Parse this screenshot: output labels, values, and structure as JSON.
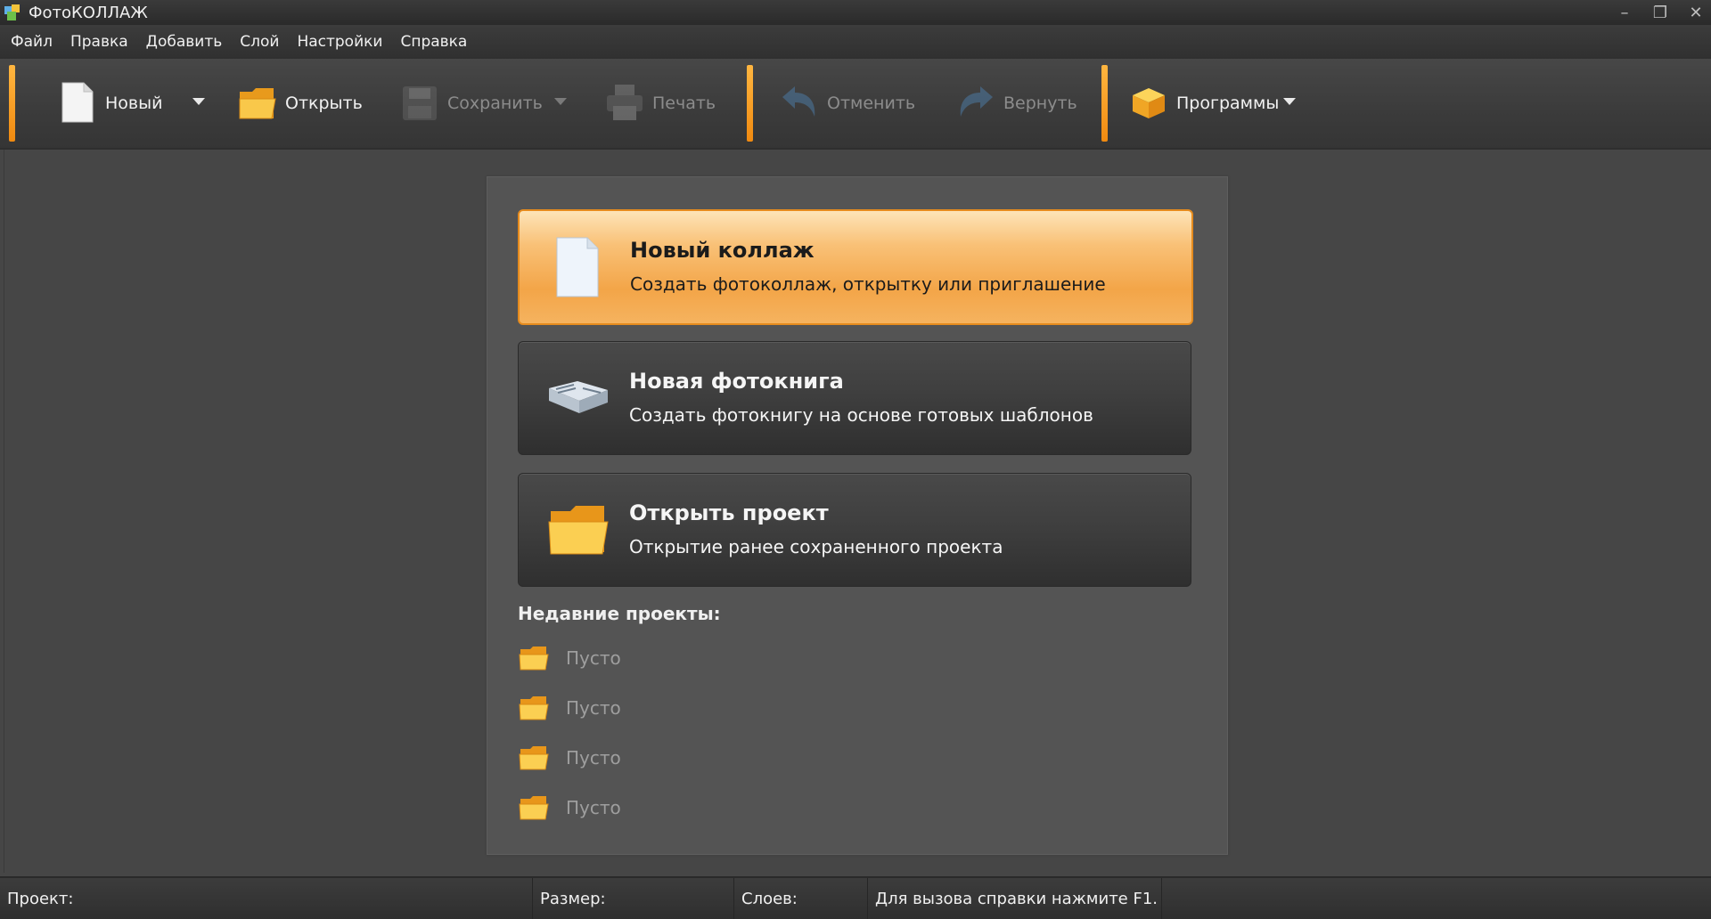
{
  "window": {
    "title": "ФотоКОЛЛАЖ",
    "minimize": "–",
    "restore": "❐",
    "close": "✕"
  },
  "menu": [
    "Файл",
    "Правка",
    "Добавить",
    "Слой",
    "Настройки",
    "Справка"
  ],
  "toolbar": {
    "new_label": "Новый",
    "open_label": "Открыть",
    "save_label": "Сохранить",
    "print_label": "Печать",
    "undo_label": "Отменить",
    "redo_label": "Вернуть",
    "programs_label": "Программы"
  },
  "start": {
    "cards": [
      {
        "title": "Новый коллаж",
        "subtitle": "Создать фотоколлаж, открытку или приглашение",
        "icon": "blank-page-icon"
      },
      {
        "title": "Новая фотокнига",
        "subtitle": "Создать фотокнигу на основе готовых шаблонов",
        "icon": "photobook-icon"
      },
      {
        "title": "Открыть проект",
        "subtitle": "Открытие ранее сохраненного проекта",
        "icon": "folder-icon"
      }
    ],
    "recent_title": "Недавние проекты:",
    "recent": [
      "Пусто",
      "Пусто",
      "Пусто",
      "Пусто"
    ]
  },
  "status": {
    "project": "Проект:",
    "size": "Размер:",
    "layers": "Слоев:",
    "help": "Для вызова справки нажмите F1."
  },
  "colors": {
    "accent": "#f5a23a",
    "background": "#464646",
    "panel": "#545454"
  }
}
